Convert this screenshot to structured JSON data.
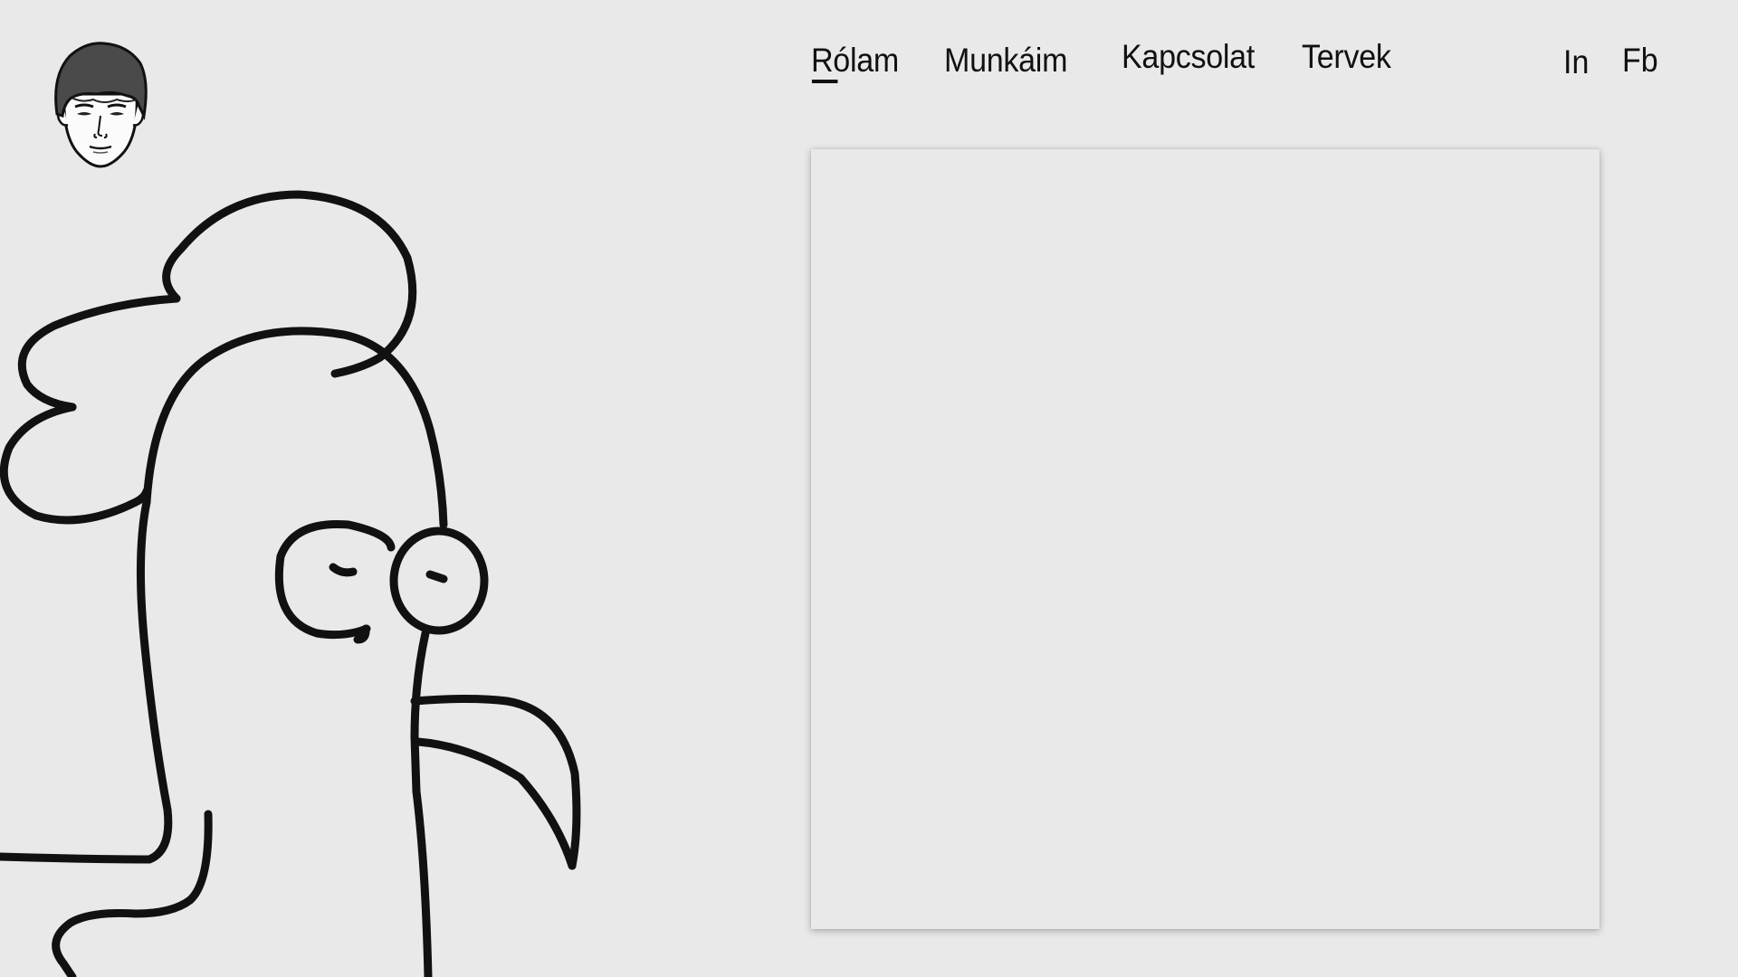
{
  "header": {
    "avatar_icon": "cartoon-face-avatar-icon"
  },
  "nav": {
    "items": [
      {
        "label": "Rólam",
        "active": true
      },
      {
        "label": "Munkáim",
        "active": false
      },
      {
        "label": "Kapcsolat",
        "active": false
      },
      {
        "label": "Tervek",
        "active": false
      }
    ]
  },
  "social": {
    "linkedin_label": "In",
    "facebook_label": "Fb"
  },
  "illustration": {
    "icon": "rooster-drawing-icon"
  },
  "colors": {
    "background": "#e9e9e9",
    "text": "#111111"
  }
}
